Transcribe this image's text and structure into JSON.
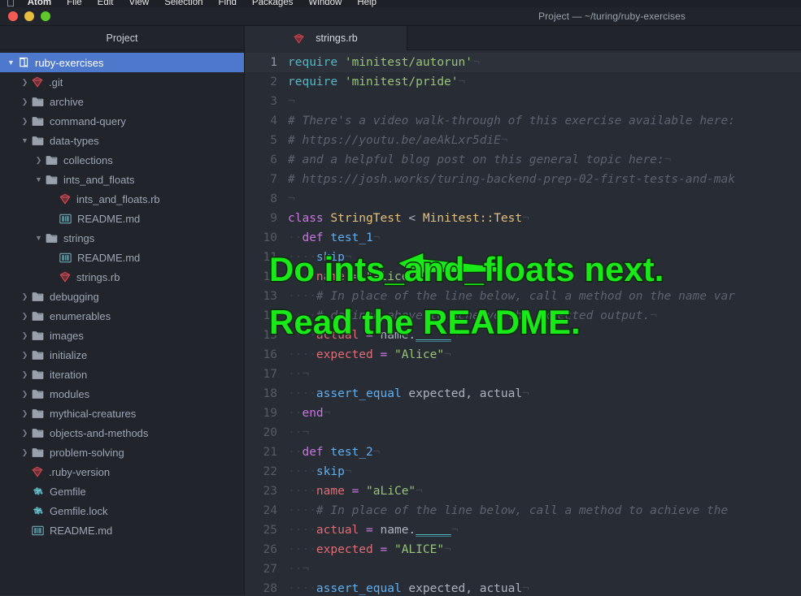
{
  "menubar": {
    "apple": "",
    "items": [
      "Atom",
      "File",
      "Edit",
      "View",
      "Selection",
      "Find",
      "Packages",
      "Window",
      "Help"
    ]
  },
  "window": {
    "title": "Project — ~/turing/ruby-exercises"
  },
  "tabs": [
    {
      "label": "Project",
      "icon": "",
      "active": false
    },
    {
      "label": "strings.rb",
      "icon": "ruby-icon",
      "active": true
    }
  ],
  "sidebar": {
    "items": [
      {
        "label": "ruby-exercises",
        "depth": 0,
        "twisty": "down",
        "icon": "repo-icon",
        "selected": true
      },
      {
        "label": ".git",
        "depth": 1,
        "twisty": "right",
        "icon": "ruby-icon",
        "selected": false
      },
      {
        "label": "archive",
        "depth": 1,
        "twisty": "right",
        "icon": "folder-icon",
        "selected": false
      },
      {
        "label": "command-query",
        "depth": 1,
        "twisty": "right",
        "icon": "folder-icon",
        "selected": false
      },
      {
        "label": "data-types",
        "depth": 1,
        "twisty": "down",
        "icon": "folder-icon",
        "selected": false
      },
      {
        "label": "collections",
        "depth": 2,
        "twisty": "right",
        "icon": "folder-icon",
        "selected": false
      },
      {
        "label": "ints_and_floats",
        "depth": 2,
        "twisty": "down",
        "icon": "folder-icon",
        "selected": false
      },
      {
        "label": "ints_and_floats.rb",
        "depth": 3,
        "twisty": "none",
        "icon": "ruby-icon",
        "selected": false
      },
      {
        "label": "README.md",
        "depth": 3,
        "twisty": "none",
        "icon": "book-icon",
        "selected": false
      },
      {
        "label": "strings",
        "depth": 2,
        "twisty": "down",
        "icon": "folder-icon",
        "selected": false
      },
      {
        "label": "README.md",
        "depth": 3,
        "twisty": "none",
        "icon": "book-icon",
        "selected": false
      },
      {
        "label": "strings.rb",
        "depth": 3,
        "twisty": "none",
        "icon": "ruby-icon",
        "selected": false
      },
      {
        "label": "debugging",
        "depth": 1,
        "twisty": "right",
        "icon": "folder-icon",
        "selected": false
      },
      {
        "label": "enumerables",
        "depth": 1,
        "twisty": "right",
        "icon": "folder-icon",
        "selected": false
      },
      {
        "label": "images",
        "depth": 1,
        "twisty": "right",
        "icon": "folder-icon",
        "selected": false
      },
      {
        "label": "initialize",
        "depth": 1,
        "twisty": "right",
        "icon": "folder-icon",
        "selected": false
      },
      {
        "label": "iteration",
        "depth": 1,
        "twisty": "right",
        "icon": "folder-icon",
        "selected": false
      },
      {
        "label": "modules",
        "depth": 1,
        "twisty": "right",
        "icon": "folder-icon",
        "selected": false
      },
      {
        "label": "mythical-creatures",
        "depth": 1,
        "twisty": "right",
        "icon": "folder-icon",
        "selected": false
      },
      {
        "label": "objects-and-methods",
        "depth": 1,
        "twisty": "right",
        "icon": "folder-icon",
        "selected": false
      },
      {
        "label": "problem-solving",
        "depth": 1,
        "twisty": "right",
        "icon": "folder-icon",
        "selected": false
      },
      {
        "label": ".ruby-version",
        "depth": 1,
        "twisty": "none",
        "icon": "ruby-icon",
        "selected": false
      },
      {
        "label": "Gemfile",
        "depth": 1,
        "twisty": "none",
        "icon": "gem-icon",
        "selected": false
      },
      {
        "label": "Gemfile.lock",
        "depth": 1,
        "twisty": "none",
        "icon": "gem-icon",
        "selected": false
      },
      {
        "label": "README.md",
        "depth": 1,
        "twisty": "none",
        "icon": "book-icon",
        "selected": false
      }
    ]
  },
  "editor": {
    "filename": "strings.rb",
    "active_line": 1,
    "lines": [
      {
        "n": 1,
        "tokens": [
          {
            "t": "require",
            "c": "builtin"
          },
          {
            "t": " ",
            "c": "plain"
          },
          {
            "t": "'minitest/autorun'",
            "c": "str"
          },
          {
            "t": "¬",
            "c": "cr"
          }
        ]
      },
      {
        "n": 2,
        "tokens": [
          {
            "t": "require",
            "c": "builtin"
          },
          {
            "t": " ",
            "c": "plain"
          },
          {
            "t": "'minitest/pride'",
            "c": "str"
          },
          {
            "t": "¬",
            "c": "cr"
          }
        ]
      },
      {
        "n": 3,
        "tokens": [
          {
            "t": "¬",
            "c": "cr"
          }
        ]
      },
      {
        "n": 4,
        "tokens": [
          {
            "t": "# There's a video walk-through of this exercise available here:",
            "c": "com"
          }
        ]
      },
      {
        "n": 5,
        "tokens": [
          {
            "t": "# https://youtu.be/aeAkLxr5diE",
            "c": "com"
          },
          {
            "t": "¬",
            "c": "cr"
          }
        ]
      },
      {
        "n": 6,
        "tokens": [
          {
            "t": "# and a helpful blog post on this general topic here:",
            "c": "com"
          },
          {
            "t": "¬",
            "c": "cr"
          }
        ]
      },
      {
        "n": 7,
        "tokens": [
          {
            "t": "# https://josh.works/turing-backend-prep-02-first-tests-and-mak",
            "c": "com"
          }
        ]
      },
      {
        "n": 8,
        "tokens": [
          {
            "t": "¬",
            "c": "cr"
          }
        ]
      },
      {
        "n": 9,
        "tokens": [
          {
            "t": "class",
            "c": "kw"
          },
          {
            "t": " ",
            "c": "plain"
          },
          {
            "t": "StringTest",
            "c": "const"
          },
          {
            "t": " < ",
            "c": "plain"
          },
          {
            "t": "Minitest::Test",
            "c": "const"
          },
          {
            "t": "¬",
            "c": "cr"
          }
        ]
      },
      {
        "n": 10,
        "tokens": [
          {
            "t": "··",
            "c": "dot"
          },
          {
            "t": "def",
            "c": "kw"
          },
          {
            "t": " ",
            "c": "plain"
          },
          {
            "t": "test_1",
            "c": "func"
          },
          {
            "t": "¬",
            "c": "cr"
          }
        ]
      },
      {
        "n": 11,
        "tokens": [
          {
            "t": "····",
            "c": "dot"
          },
          {
            "t": "skip",
            "c": "func"
          },
          {
            "t": "¬",
            "c": "cr"
          }
        ]
      },
      {
        "n": 12,
        "tokens": [
          {
            "t": "····",
            "c": "dot"
          },
          {
            "t": "name",
            "c": "var"
          },
          {
            "t": " ",
            "c": "plain"
          },
          {
            "t": "=",
            "c": "op"
          },
          {
            "t": " ",
            "c": "plain"
          },
          {
            "t": "\"alice\"",
            "c": "str"
          },
          {
            "t": "¬",
            "c": "cr"
          }
        ]
      },
      {
        "n": 13,
        "tokens": [
          {
            "t": "····",
            "c": "dot"
          },
          {
            "t": "# In place of the line below, call a method on the name var",
            "c": "com"
          }
        ]
      },
      {
        "n": 14,
        "tokens": [
          {
            "t": "····",
            "c": "dot"
          },
          {
            "t": "# defined above to acheive the expected output.",
            "c": "com"
          },
          {
            "t": "¬",
            "c": "cr"
          }
        ]
      },
      {
        "n": 15,
        "tokens": [
          {
            "t": "····",
            "c": "dot"
          },
          {
            "t": "actual",
            "c": "var"
          },
          {
            "t": " ",
            "c": "plain"
          },
          {
            "t": "=",
            "c": "op"
          },
          {
            "t": " ",
            "c": "plain"
          },
          {
            "t": "name.",
            "c": "plain"
          },
          {
            "t": "_____",
            "c": "blank"
          },
          {
            "t": "¬",
            "c": "cr"
          }
        ]
      },
      {
        "n": 16,
        "tokens": [
          {
            "t": "····",
            "c": "dot"
          },
          {
            "t": "expected",
            "c": "var"
          },
          {
            "t": " ",
            "c": "plain"
          },
          {
            "t": "=",
            "c": "op"
          },
          {
            "t": " ",
            "c": "plain"
          },
          {
            "t": "\"Alice\"",
            "c": "str"
          },
          {
            "t": "¬",
            "c": "cr"
          }
        ]
      },
      {
        "n": 17,
        "tokens": [
          {
            "t": "··",
            "c": "dot"
          },
          {
            "t": "¬",
            "c": "cr"
          }
        ]
      },
      {
        "n": 18,
        "tokens": [
          {
            "t": "····",
            "c": "dot"
          },
          {
            "t": "assert_equal",
            "c": "func"
          },
          {
            "t": " expected, actual",
            "c": "plain"
          },
          {
            "t": "¬",
            "c": "cr"
          }
        ]
      },
      {
        "n": 19,
        "tokens": [
          {
            "t": "··",
            "c": "dot"
          },
          {
            "t": "end",
            "c": "kw"
          },
          {
            "t": "¬",
            "c": "cr"
          }
        ]
      },
      {
        "n": 20,
        "tokens": [
          {
            "t": "··",
            "c": "dot"
          },
          {
            "t": "¬",
            "c": "cr"
          }
        ]
      },
      {
        "n": 21,
        "tokens": [
          {
            "t": "··",
            "c": "dot"
          },
          {
            "t": "def",
            "c": "kw"
          },
          {
            "t": " ",
            "c": "plain"
          },
          {
            "t": "test_2",
            "c": "func"
          },
          {
            "t": "¬",
            "c": "cr"
          }
        ]
      },
      {
        "n": 22,
        "tokens": [
          {
            "t": "····",
            "c": "dot"
          },
          {
            "t": "skip",
            "c": "func"
          },
          {
            "t": "¬",
            "c": "cr"
          }
        ]
      },
      {
        "n": 23,
        "tokens": [
          {
            "t": "····",
            "c": "dot"
          },
          {
            "t": "name",
            "c": "var"
          },
          {
            "t": " ",
            "c": "plain"
          },
          {
            "t": "=",
            "c": "op"
          },
          {
            "t": " ",
            "c": "plain"
          },
          {
            "t": "\"aLiCe\"",
            "c": "str"
          },
          {
            "t": "¬",
            "c": "cr"
          }
        ]
      },
      {
        "n": 24,
        "tokens": [
          {
            "t": "····",
            "c": "dot"
          },
          {
            "t": "# In place of the line below, call a method to achieve the",
            "c": "com"
          }
        ]
      },
      {
        "n": 25,
        "tokens": [
          {
            "t": "····",
            "c": "dot"
          },
          {
            "t": "actual",
            "c": "var"
          },
          {
            "t": " ",
            "c": "plain"
          },
          {
            "t": "=",
            "c": "op"
          },
          {
            "t": " ",
            "c": "plain"
          },
          {
            "t": "name.",
            "c": "plain"
          },
          {
            "t": "_____",
            "c": "blank"
          },
          {
            "t": "¬",
            "c": "cr"
          }
        ]
      },
      {
        "n": 26,
        "tokens": [
          {
            "t": "····",
            "c": "dot"
          },
          {
            "t": "expected",
            "c": "var"
          },
          {
            "t": " ",
            "c": "plain"
          },
          {
            "t": "=",
            "c": "op"
          },
          {
            "t": " ",
            "c": "plain"
          },
          {
            "t": "\"ALICE\"",
            "c": "str"
          },
          {
            "t": "¬",
            "c": "cr"
          }
        ]
      },
      {
        "n": 27,
        "tokens": [
          {
            "t": "··",
            "c": "dot"
          },
          {
            "t": "¬",
            "c": "cr"
          }
        ]
      },
      {
        "n": 28,
        "tokens": [
          {
            "t": "····",
            "c": "dot"
          },
          {
            "t": "assert_equal",
            "c": "func"
          },
          {
            "t": " expected, actual",
            "c": "plain"
          },
          {
            "t": "¬",
            "c": "cr"
          }
        ]
      }
    ]
  },
  "annotation": {
    "line1": "Do ints_and_floats next.",
    "line2": "Read the README.",
    "color": "#19e819",
    "arrow": "left-arrow"
  }
}
